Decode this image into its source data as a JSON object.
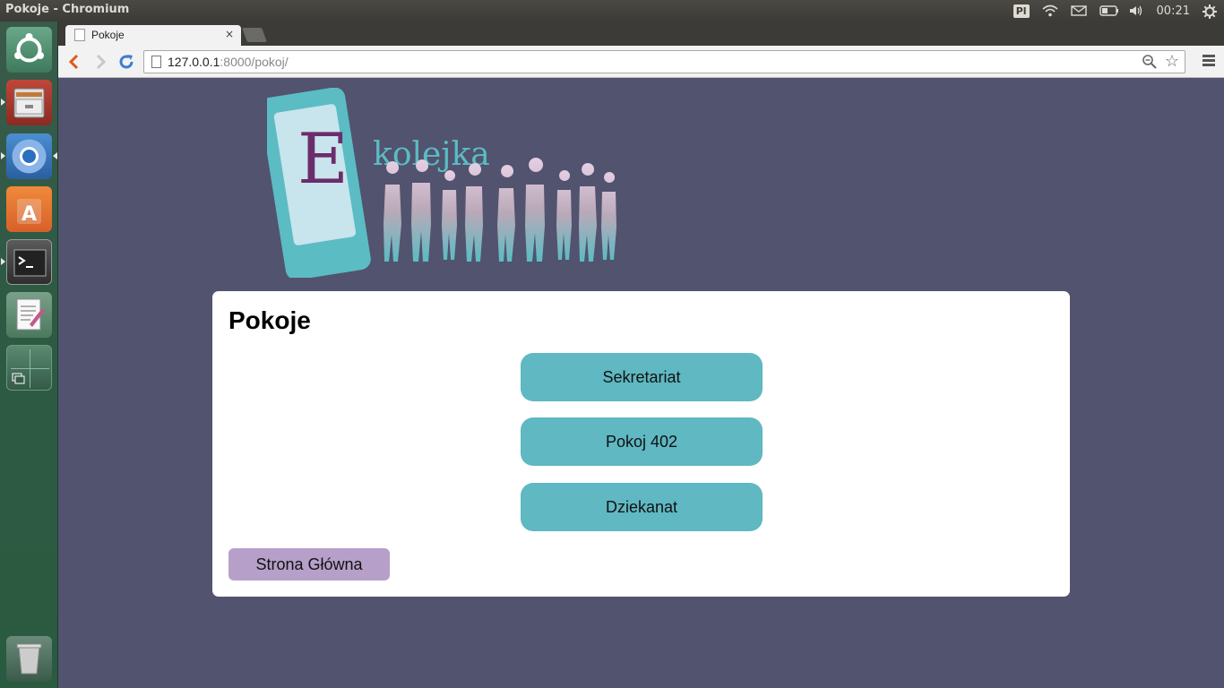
{
  "window": {
    "title": "Pokoje - Chromium"
  },
  "system_tray": {
    "keyboard_layout": "Pl",
    "clock": "00:21"
  },
  "launcher": {
    "items": [
      "ubuntu-dash",
      "file-manager",
      "chromium",
      "software-center",
      "terminal",
      "text-editor",
      "workspace-switcher",
      "trash"
    ]
  },
  "browser": {
    "tab": {
      "title": "Pokoje",
      "close": "×"
    },
    "url": {
      "host": "127.0.0.1",
      "rest": ":8000/pokoj/"
    }
  },
  "logo": {
    "letter": "E",
    "text": "kolejka"
  },
  "page": {
    "heading": "Pokoje",
    "rooms": [
      "Sekretariat",
      "Pokoj 402",
      "Dziekanat"
    ],
    "home_button": "Strona Główna"
  },
  "colors": {
    "page_bg": "#52536e",
    "room_button": "#5fb8c2",
    "home_button": "#b6a0c9",
    "logo_purple": "#6b2d6b",
    "logo_teal": "#5bbcc4"
  }
}
